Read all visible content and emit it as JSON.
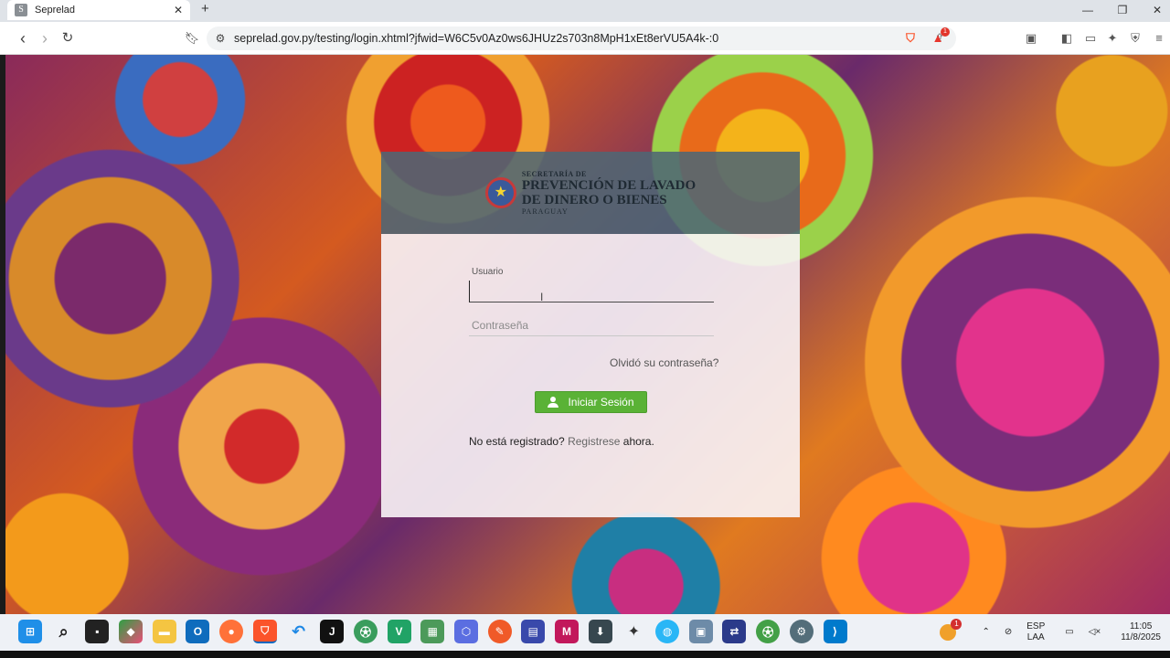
{
  "browser": {
    "tab_title": "Seprelad",
    "tab_favicon": "S",
    "url": "seprelad.gov.py/testing/login.xhtml?jfwid=W6C5v0Az0ws6JHUz2s703n8MpH1xEt8erVU5A4k-:0",
    "shield_badge": "1"
  },
  "header": {
    "logo_sup": "SECRETARÍA DE",
    "logo_line1": "PREVENCIÓN DE LAVADO",
    "logo_line2": "DE DINERO O BIENES",
    "logo_country": "PARAGUAY"
  },
  "form": {
    "user_label": "Usuario",
    "user_value": "",
    "password_placeholder": "Contraseña",
    "forgot_link": "Olvidó su contraseña?",
    "login_button": "Iniciar Sesión",
    "register_prefix": "No está registrado?",
    "register_link": "Registrese",
    "register_suffix": "ahora."
  },
  "taskbar": {
    "language_line1": "ESP",
    "language_line2": "LAA",
    "time": "11:05",
    "date": "11/8/2025",
    "notification_count": "1"
  },
  "colors": {
    "login_button": "#5ab236",
    "header_bg": "#4e6674"
  }
}
